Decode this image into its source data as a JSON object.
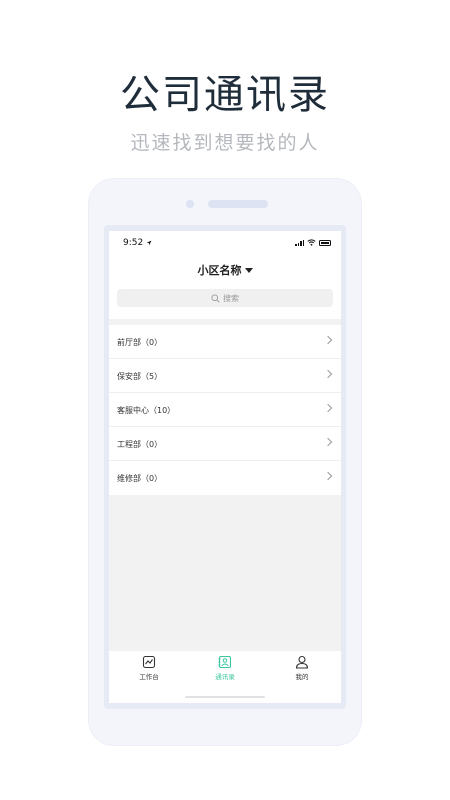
{
  "promo": {
    "title": "公司通讯录",
    "subtitle": "迅速找到想要找的人"
  },
  "status_bar": {
    "time": "9:52"
  },
  "header": {
    "title": "小区名称"
  },
  "search": {
    "placeholder": "搜索"
  },
  "departments": [
    {
      "label": "前厅部（0）"
    },
    {
      "label": "保安部（5）"
    },
    {
      "label": "客服中心（10）"
    },
    {
      "label": "工程部（0）"
    },
    {
      "label": "维修部（0）"
    }
  ],
  "tabbar": {
    "items": [
      {
        "label": "工作台",
        "icon": "chart-icon"
      },
      {
        "label": "通讯录",
        "icon": "contacts-icon"
      },
      {
        "label": "我的",
        "icon": "person-icon"
      }
    ],
    "active": "通讯录"
  },
  "colors": {
    "accent": "#3cc6a0",
    "title_text": "#1f2c3a",
    "subtitle_text": "#b4b8bd",
    "phone_frame": "#f3f5fb"
  }
}
